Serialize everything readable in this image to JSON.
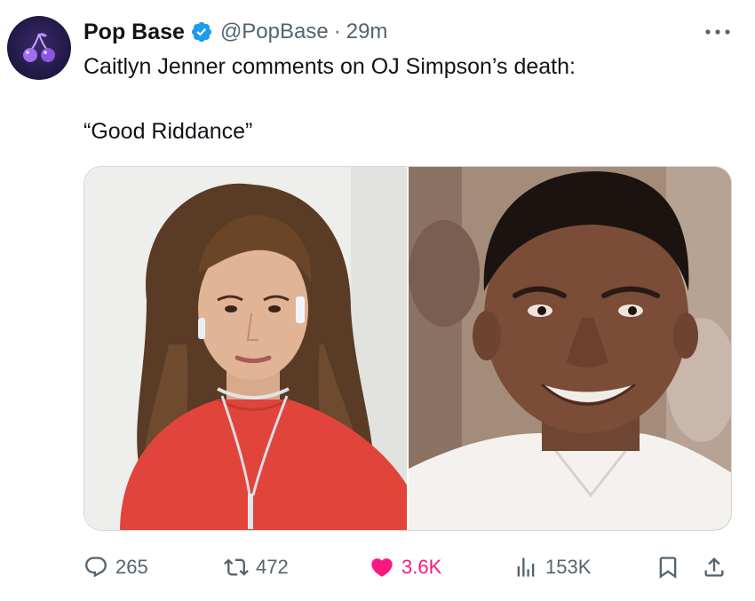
{
  "tweet": {
    "author": {
      "display_name": "Pop Base",
      "handle": "@PopBase",
      "separator": "·",
      "time": "29m",
      "verified": true,
      "avatar_icon": "cherries-icon"
    },
    "text_line_1": "Caitlyn Jenner comments on OJ Simpson’s death:",
    "text_line_2": "“Good Riddance”",
    "media": [
      {
        "kind": "photo",
        "subject": "woman-red-dress-portrait"
      },
      {
        "kind": "photo",
        "subject": "smiling-man-portrait"
      }
    ],
    "metrics": {
      "replies": "265",
      "reposts": "472",
      "likes": "3.6K",
      "views": "153K"
    }
  },
  "colors": {
    "text": "#0f1419",
    "secondary": "#536471",
    "verified": "#1d9bf0",
    "like_active": "#f91880",
    "border": "#cfd9de"
  },
  "icons": {
    "reply": "reply-icon",
    "repost": "repost-icon",
    "like": "heart-icon",
    "views": "views-icon",
    "bookmark": "bookmark-icon",
    "share": "share-icon",
    "more": "more-icon"
  }
}
